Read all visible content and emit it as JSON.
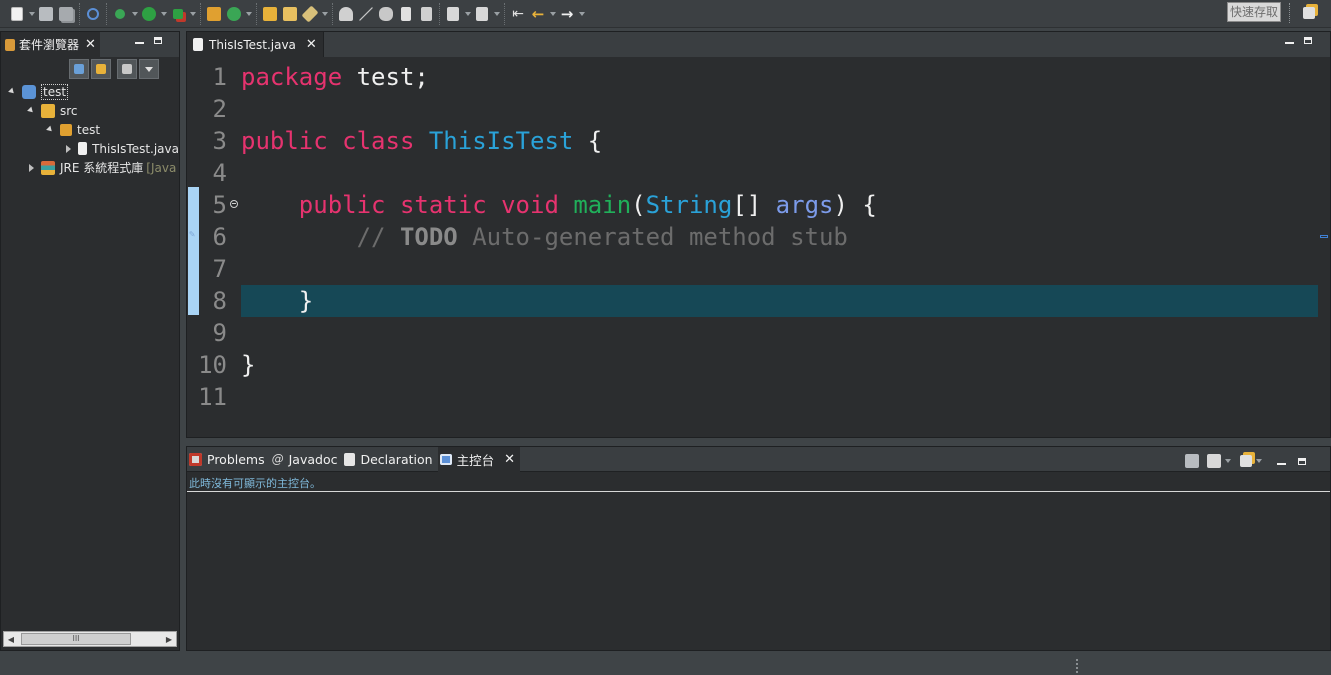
{
  "toolbar": {
    "quick_access": "快速存取"
  },
  "package_explorer": {
    "tab_label": "套件瀏覽器",
    "tree": [
      {
        "label": "test",
        "suffix": ""
      },
      {
        "label": "src",
        "suffix": ""
      },
      {
        "label": "test",
        "suffix": ""
      },
      {
        "label": "ThisIsTest.java",
        "suffix": ""
      },
      {
        "label": "JRE 系統程式庫",
        "suffix": "[Java"
      }
    ],
    "scroll_thumb": "III"
  },
  "editor": {
    "tab_label": "ThisIsTest.java",
    "line_numbers": [
      "1",
      "2",
      "3",
      "4",
      "5",
      "6",
      "7",
      "8",
      "9",
      "10",
      "11"
    ],
    "code": {
      "l1_kw": "package",
      "l1_rest": " test;",
      "l3_kw1": "public",
      "l3_kw2": "class",
      "l3_cls": "ThisIsTest",
      "l3_rest": " {",
      "l5_indent": "    ",
      "l5_kw1": "public",
      "l5_kw2": "static",
      "l5_kw3": "void",
      "l5_fn": "main",
      "l5_p1": "(",
      "l5_type": "String",
      "l5_p2": "[] ",
      "l5_param": "args",
      "l5_p3": ") {",
      "l6_indent": "        ",
      "l6_slash": "// ",
      "l6_todo": "TODO",
      "l6_rest": " Auto-generated method stub",
      "l8_text": "    }",
      "l10_text": "}"
    }
  },
  "console_view": {
    "tabs": [
      {
        "label": "Problems"
      },
      {
        "label": "Javadoc"
      },
      {
        "label": "Declaration"
      },
      {
        "label": "主控台"
      }
    ],
    "message": "此時沒有可顯示的主控台。"
  },
  "colors": {
    "keyword": "#e6336f",
    "class_name": "#2aa2d8",
    "method_name": "#20b05a",
    "parameter": "#7c9bea",
    "current_line": "#164856"
  }
}
